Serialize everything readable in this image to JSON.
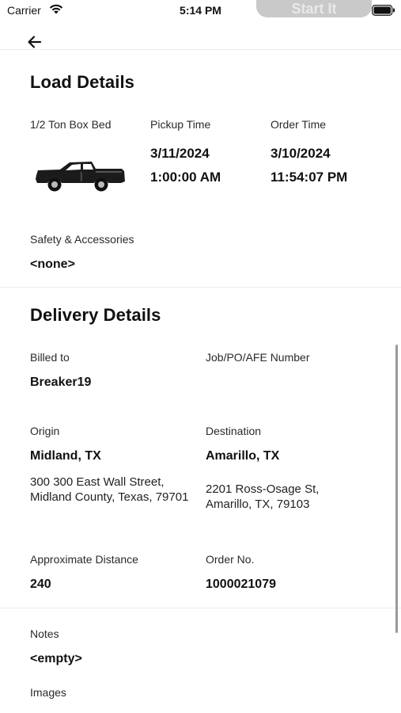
{
  "status_bar": {
    "carrier": "Carrier",
    "time": "5:14 PM",
    "pill_text": "Start It"
  },
  "load_details": {
    "title": "Load Details",
    "vehicle_label": "1/2 Ton Box Bed",
    "vehicle_icon": "pickup-truck-icon",
    "pickup_label": "Pickup Time",
    "pickup_date": "3/11/2024",
    "pickup_time": "1:00:00 AM",
    "order_label": "Order Time",
    "order_date": "3/10/2024",
    "order_time": "11:54:07 PM",
    "safety_label": "Safety & Accessories",
    "safety_value": "<none>"
  },
  "delivery_details": {
    "title": "Delivery Details",
    "billed_label": "Billed to",
    "billed_value": "Breaker19",
    "job_label": "Job/PO/AFE Number",
    "job_value": "",
    "origin_label": "Origin",
    "origin_city": "Midland, TX",
    "origin_address": "300 300 East Wall Street, Midland County, Texas, 79701",
    "destination_label": "Destination",
    "destination_city": "Amarillo, TX",
    "destination_address": "2201 Ross-Osage St, Amarillo, TX, 79103",
    "distance_label": "Approximate Distance",
    "distance_value": "240",
    "order_no_label": "Order No.",
    "order_no_value": "1000021079"
  },
  "notes": {
    "label": "Notes",
    "value": "<empty>",
    "images_label": "Images"
  },
  "colors": {
    "text": "#111111",
    "label": "#2a2a2a",
    "divider": "#ececec",
    "pill": "#c9c9c9"
  }
}
